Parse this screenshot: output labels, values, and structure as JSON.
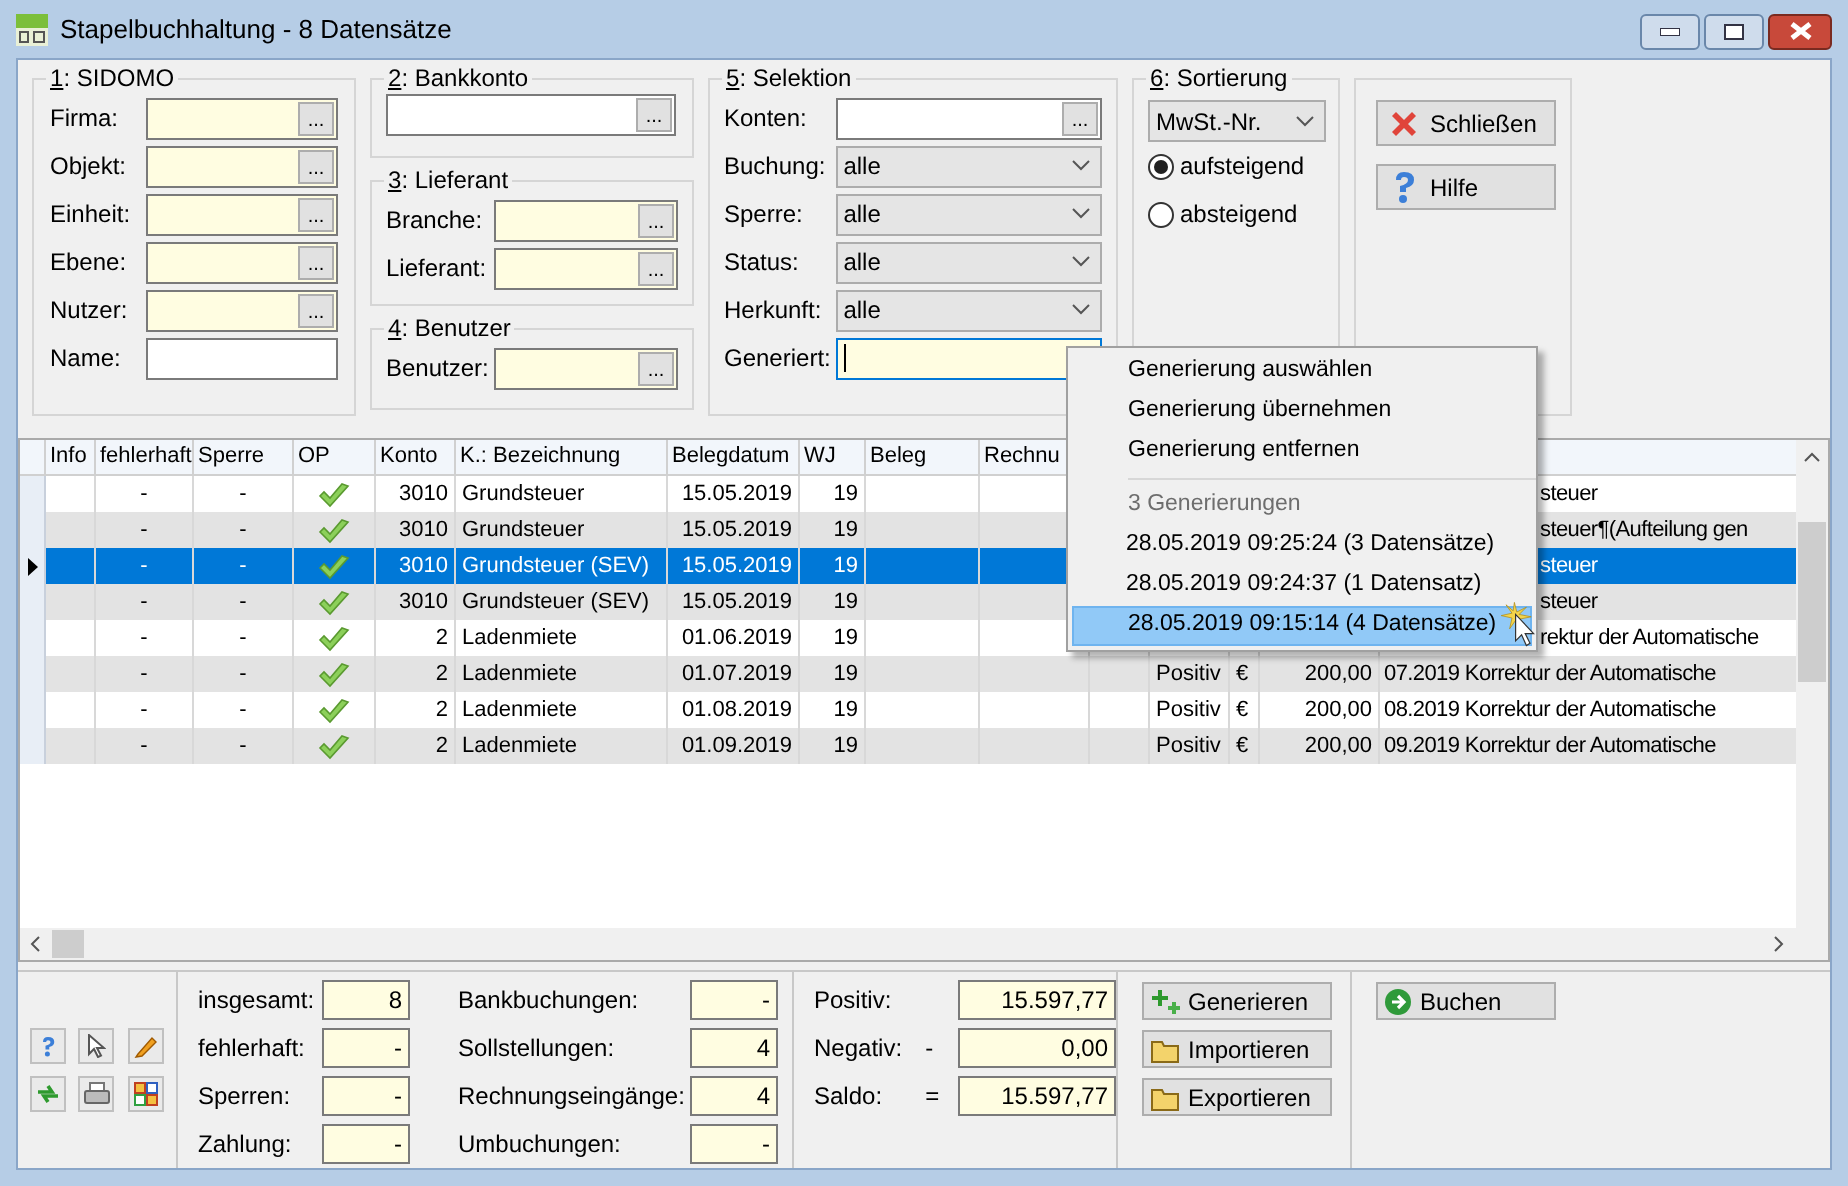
{
  "window": {
    "title": "Stapelbuchhaltung - 8 Datensätze"
  },
  "sidomo": {
    "title": "1: SIDOMO",
    "fields": [
      {
        "label": "Firma:",
        "highlighted": true,
        "button": "..."
      },
      {
        "label": "Objekt:",
        "highlighted": true,
        "button": "..."
      },
      {
        "label": "Einheit:",
        "highlighted": true,
        "button": "..."
      },
      {
        "label": "Ebene:",
        "highlighted": true,
        "button": "..."
      },
      {
        "label": "Nutzer:",
        "highlighted": true,
        "button": "..."
      },
      {
        "label": "Name:",
        "highlighted": false
      }
    ]
  },
  "bankkonto": {
    "title": "2: Bankkonto",
    "fields": [
      {
        "highlighted": false,
        "button": "..."
      }
    ]
  },
  "lieferant": {
    "title": "3: Lieferant",
    "fields": [
      {
        "label": "Branche:",
        "highlighted": true,
        "button": "..."
      },
      {
        "label": "Lieferant:",
        "highlighted": true,
        "button": "..."
      }
    ]
  },
  "benutzer": {
    "title": "4: Benutzer",
    "fields": [
      {
        "label": "Benutzer:",
        "highlighted": true,
        "button": "..."
      }
    ]
  },
  "selektion": {
    "title": "5: Selektion",
    "fields": [
      {
        "label": "Konten:",
        "kind": "lookup",
        "highlighted": false,
        "button": "..."
      },
      {
        "label": "Buchung:",
        "kind": "dropdown",
        "value": "alle"
      },
      {
        "label": "Sperre:",
        "kind": "dropdown",
        "value": "alle"
      },
      {
        "label": "Status:",
        "kind": "dropdown",
        "value": "alle"
      },
      {
        "label": "Herkunft:",
        "kind": "dropdown",
        "value": "alle"
      },
      {
        "label": "Generiert:",
        "kind": "text",
        "highlighted": true,
        "focused": true
      }
    ]
  },
  "sortierung": {
    "title": "6: Sortierung",
    "value": "MwSt.-Nr.",
    "options": [
      {
        "label": "aufsteigend",
        "selected": true
      },
      {
        "label": "absteigend",
        "selected": false
      }
    ]
  },
  "actions": [
    {
      "label": "Schließen",
      "kind": "close"
    },
    {
      "label": "Hilfe",
      "kind": "help"
    }
  ],
  "table": {
    "columns": [
      "Info",
      "fehlerhaft",
      "Sperre",
      "OP",
      "Konto",
      "K.: Bezeichnung",
      "Belegdatum",
      "WJ",
      "Beleg",
      "Rechnu"
    ],
    "rows": [
      {
        "selected": false,
        "kind": "covered",
        "fehlerhaft": "-",
        "sperre": "-",
        "op": true,
        "konto": "3010",
        "bezeichnung": "Grundsteuer",
        "belegdatum": "15.05.2019",
        "wj": "19",
        "text": "steuer"
      },
      {
        "selected": false,
        "kind": "covered",
        "fehlerhaft": "-",
        "sperre": "-",
        "op": true,
        "konto": "3010",
        "bezeichnung": "Grundsteuer",
        "belegdatum": "15.05.2019",
        "wj": "19",
        "text": "steuer¶(Aufteilung gen"
      },
      {
        "selected": true,
        "kind": "covered",
        "fehlerhaft": "-",
        "sperre": "-",
        "op": true,
        "konto": "3010",
        "bezeichnung": "Grundsteuer (SEV)",
        "belegdatum": "15.05.2019",
        "wj": "19",
        "text": "steuer"
      },
      {
        "selected": false,
        "kind": "covered",
        "fehlerhaft": "-",
        "sperre": "-",
        "op": true,
        "konto": "3010",
        "bezeichnung": "Grundsteuer (SEV)",
        "belegdatum": "15.05.2019",
        "wj": "19",
        "text": "steuer"
      },
      {
        "selected": false,
        "kind": "covered",
        "fehlerhaft": "-",
        "sperre": "-",
        "op": true,
        "konto": "2",
        "bezeichnung": "Ladenmiete",
        "belegdatum": "01.06.2019",
        "wj": "19",
        "text": "rektur der Automatische"
      },
      {
        "selected": false,
        "kind": "full",
        "fehlerhaft": "-",
        "sperre": "-",
        "op": true,
        "konto": "2",
        "bezeichnung": "Ladenmiete",
        "belegdatum": "01.07.2019",
        "wj": "19",
        "art": "Positiv",
        "currency": "€",
        "amount": "200,00",
        "text": "07.2019 Korrektur der Automatische"
      },
      {
        "selected": false,
        "kind": "full",
        "fehlerhaft": "-",
        "sperre": "-",
        "op": true,
        "konto": "2",
        "bezeichnung": "Ladenmiete",
        "belegdatum": "01.08.2019",
        "wj": "19",
        "art": "Positiv",
        "currency": "€",
        "amount": "200,00",
        "text": "08.2019 Korrektur der Automatische"
      },
      {
        "selected": false,
        "kind": "full",
        "fehlerhaft": "-",
        "sperre": "-",
        "op": true,
        "konto": "2",
        "bezeichnung": "Ladenmiete",
        "belegdatum": "01.09.2019",
        "wj": "19",
        "art": "Positiv",
        "currency": "€",
        "amount": "200,00",
        "text": "09.2019 Korrektur der Automatische"
      }
    ]
  },
  "menu": [
    {
      "kind": "action",
      "label": "Generierung auswählen"
    },
    {
      "kind": "action",
      "label": "Generierung übernehmen"
    },
    {
      "kind": "action",
      "label": "Generierung entfernen"
    },
    {
      "kind": "header",
      "label": "3 Generierungen"
    },
    {
      "kind": "generation",
      "label": "28.05.2019 09:25:24 (3 Datensätze)",
      "selected": false
    },
    {
      "kind": "generation",
      "label": "28.05.2019 09:24:37 (1 Datensatz)",
      "selected": false
    },
    {
      "kind": "generation",
      "label": "28.05.2019 09:15:14 (4 Datensätze)",
      "selected": true
    }
  ],
  "stats": [
    {
      "label": "insgesamt:",
      "value": "8"
    },
    {
      "label": "Bankbuchungen:",
      "value": "-"
    },
    {
      "label": "fehlerhaft:",
      "value": "-"
    },
    {
      "label": "Sollstellungen:",
      "value": "4"
    },
    {
      "label": "Sperren:",
      "value": "-"
    },
    {
      "label": "Rechnungseingänge:",
      "value": "4"
    },
    {
      "label": "Zahlung:",
      "value": "-"
    },
    {
      "label": "Umbuchungen:",
      "value": "-"
    }
  ],
  "totals": [
    {
      "label": "Positiv:",
      "value": "15.597,77"
    },
    {
      "label": "Negativ:",
      "sign": "-",
      "value": "0,00"
    },
    {
      "label": "Saldo:",
      "sign": "=",
      "value": "15.597,77"
    }
  ],
  "tools": [
    {
      "label": "Generieren",
      "kind": "generate"
    },
    {
      "label": "Importieren",
      "kind": "import"
    },
    {
      "label": "Exportieren",
      "kind": "export"
    }
  ],
  "post": {
    "label": "Buchen"
  }
}
